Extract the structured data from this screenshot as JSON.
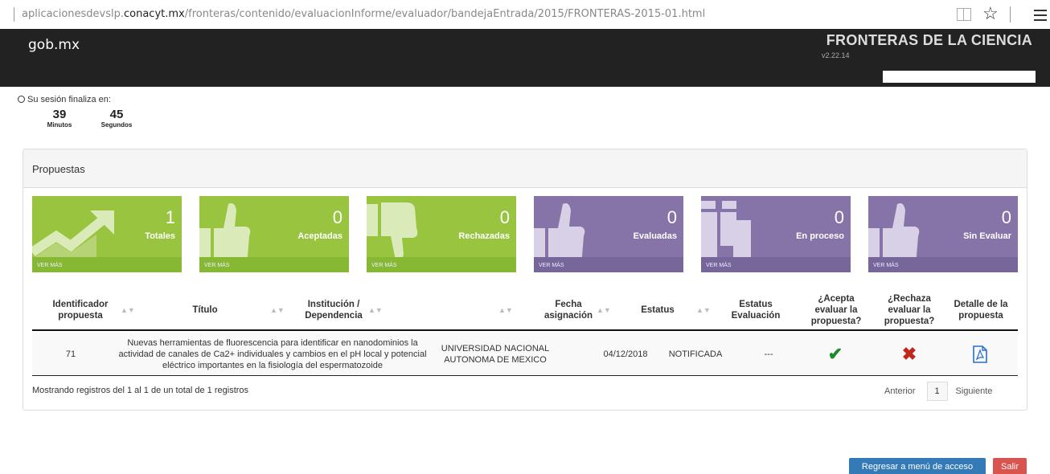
{
  "browser": {
    "url_prefix": "aplicacionesdevslp.",
    "url_domain": "conacyt.mx",
    "url_path": "/fronteras/contenido/evaluacionInforme/evaluador/bandejaEntrada/2015/FRONTERAS-2015-01.html"
  },
  "header": {
    "logo": "gob.mx",
    "title": "FRONTERAS DE LA CIENCIA",
    "version": "v2.22.14"
  },
  "session": {
    "label": "Su sesión finaliza en:",
    "minutes": "39",
    "minutes_label": "Minutos",
    "seconds": "45",
    "seconds_label": "Segundos"
  },
  "panel": {
    "title": "Propuestas"
  },
  "tiles": [
    {
      "value": "1",
      "label": "Totales",
      "link": "VER MÁS"
    },
    {
      "value": "0",
      "label": "Aceptadas",
      "link": "VER MÁS"
    },
    {
      "value": "0",
      "label": "Rechazadas",
      "link": "VER MÁS"
    },
    {
      "value": "0",
      "label": "Evaluadas",
      "link": "VER MÁS"
    },
    {
      "value": "0",
      "label": "En proceso",
      "link": "VER MÁS"
    },
    {
      "value": "0",
      "label": "Sin Evaluar",
      "link": "VER MÁS"
    }
  ],
  "colors": {
    "green_tile": "#99c440",
    "purple_tile": "#8674a8",
    "primary_button": "#337ab7",
    "danger_button": "#d9534f"
  },
  "table": {
    "headers": {
      "id": "Identificador propuesta",
      "title": "Título",
      "institution": "Institución / Dependencia",
      "date": "Fecha asignación",
      "status": "Estatus",
      "eval_status": "Estatus Evaluación",
      "accept": "¿Acepta evaluar la propuesta?",
      "reject": "¿Rechaza evaluar la propuesta?",
      "detail": "Detalle de la propuesta"
    },
    "rows": [
      {
        "id": "71",
        "title": "Nuevas herramientas de fluorescencia para identificar en nanodominios la actividad de canales de Ca2+ individuales y cambios en el pH local y potencial eléctrico importantes en la fisiología del espermatozoide",
        "institution": "UNIVERSIDAD NACIONAL AUTONOMA DE MEXICO",
        "date": "04/12/2018",
        "status": "NOTIFICADA",
        "eval_status": "---"
      }
    ],
    "info": "Mostrando registros del 1 al 1 de un total de 1 registros",
    "pager": {
      "previous": "Anterior",
      "page": "1",
      "next": "Siguiente"
    }
  },
  "buttons": {
    "back": "Regresar a menú de acceso",
    "exit": "Salir"
  }
}
